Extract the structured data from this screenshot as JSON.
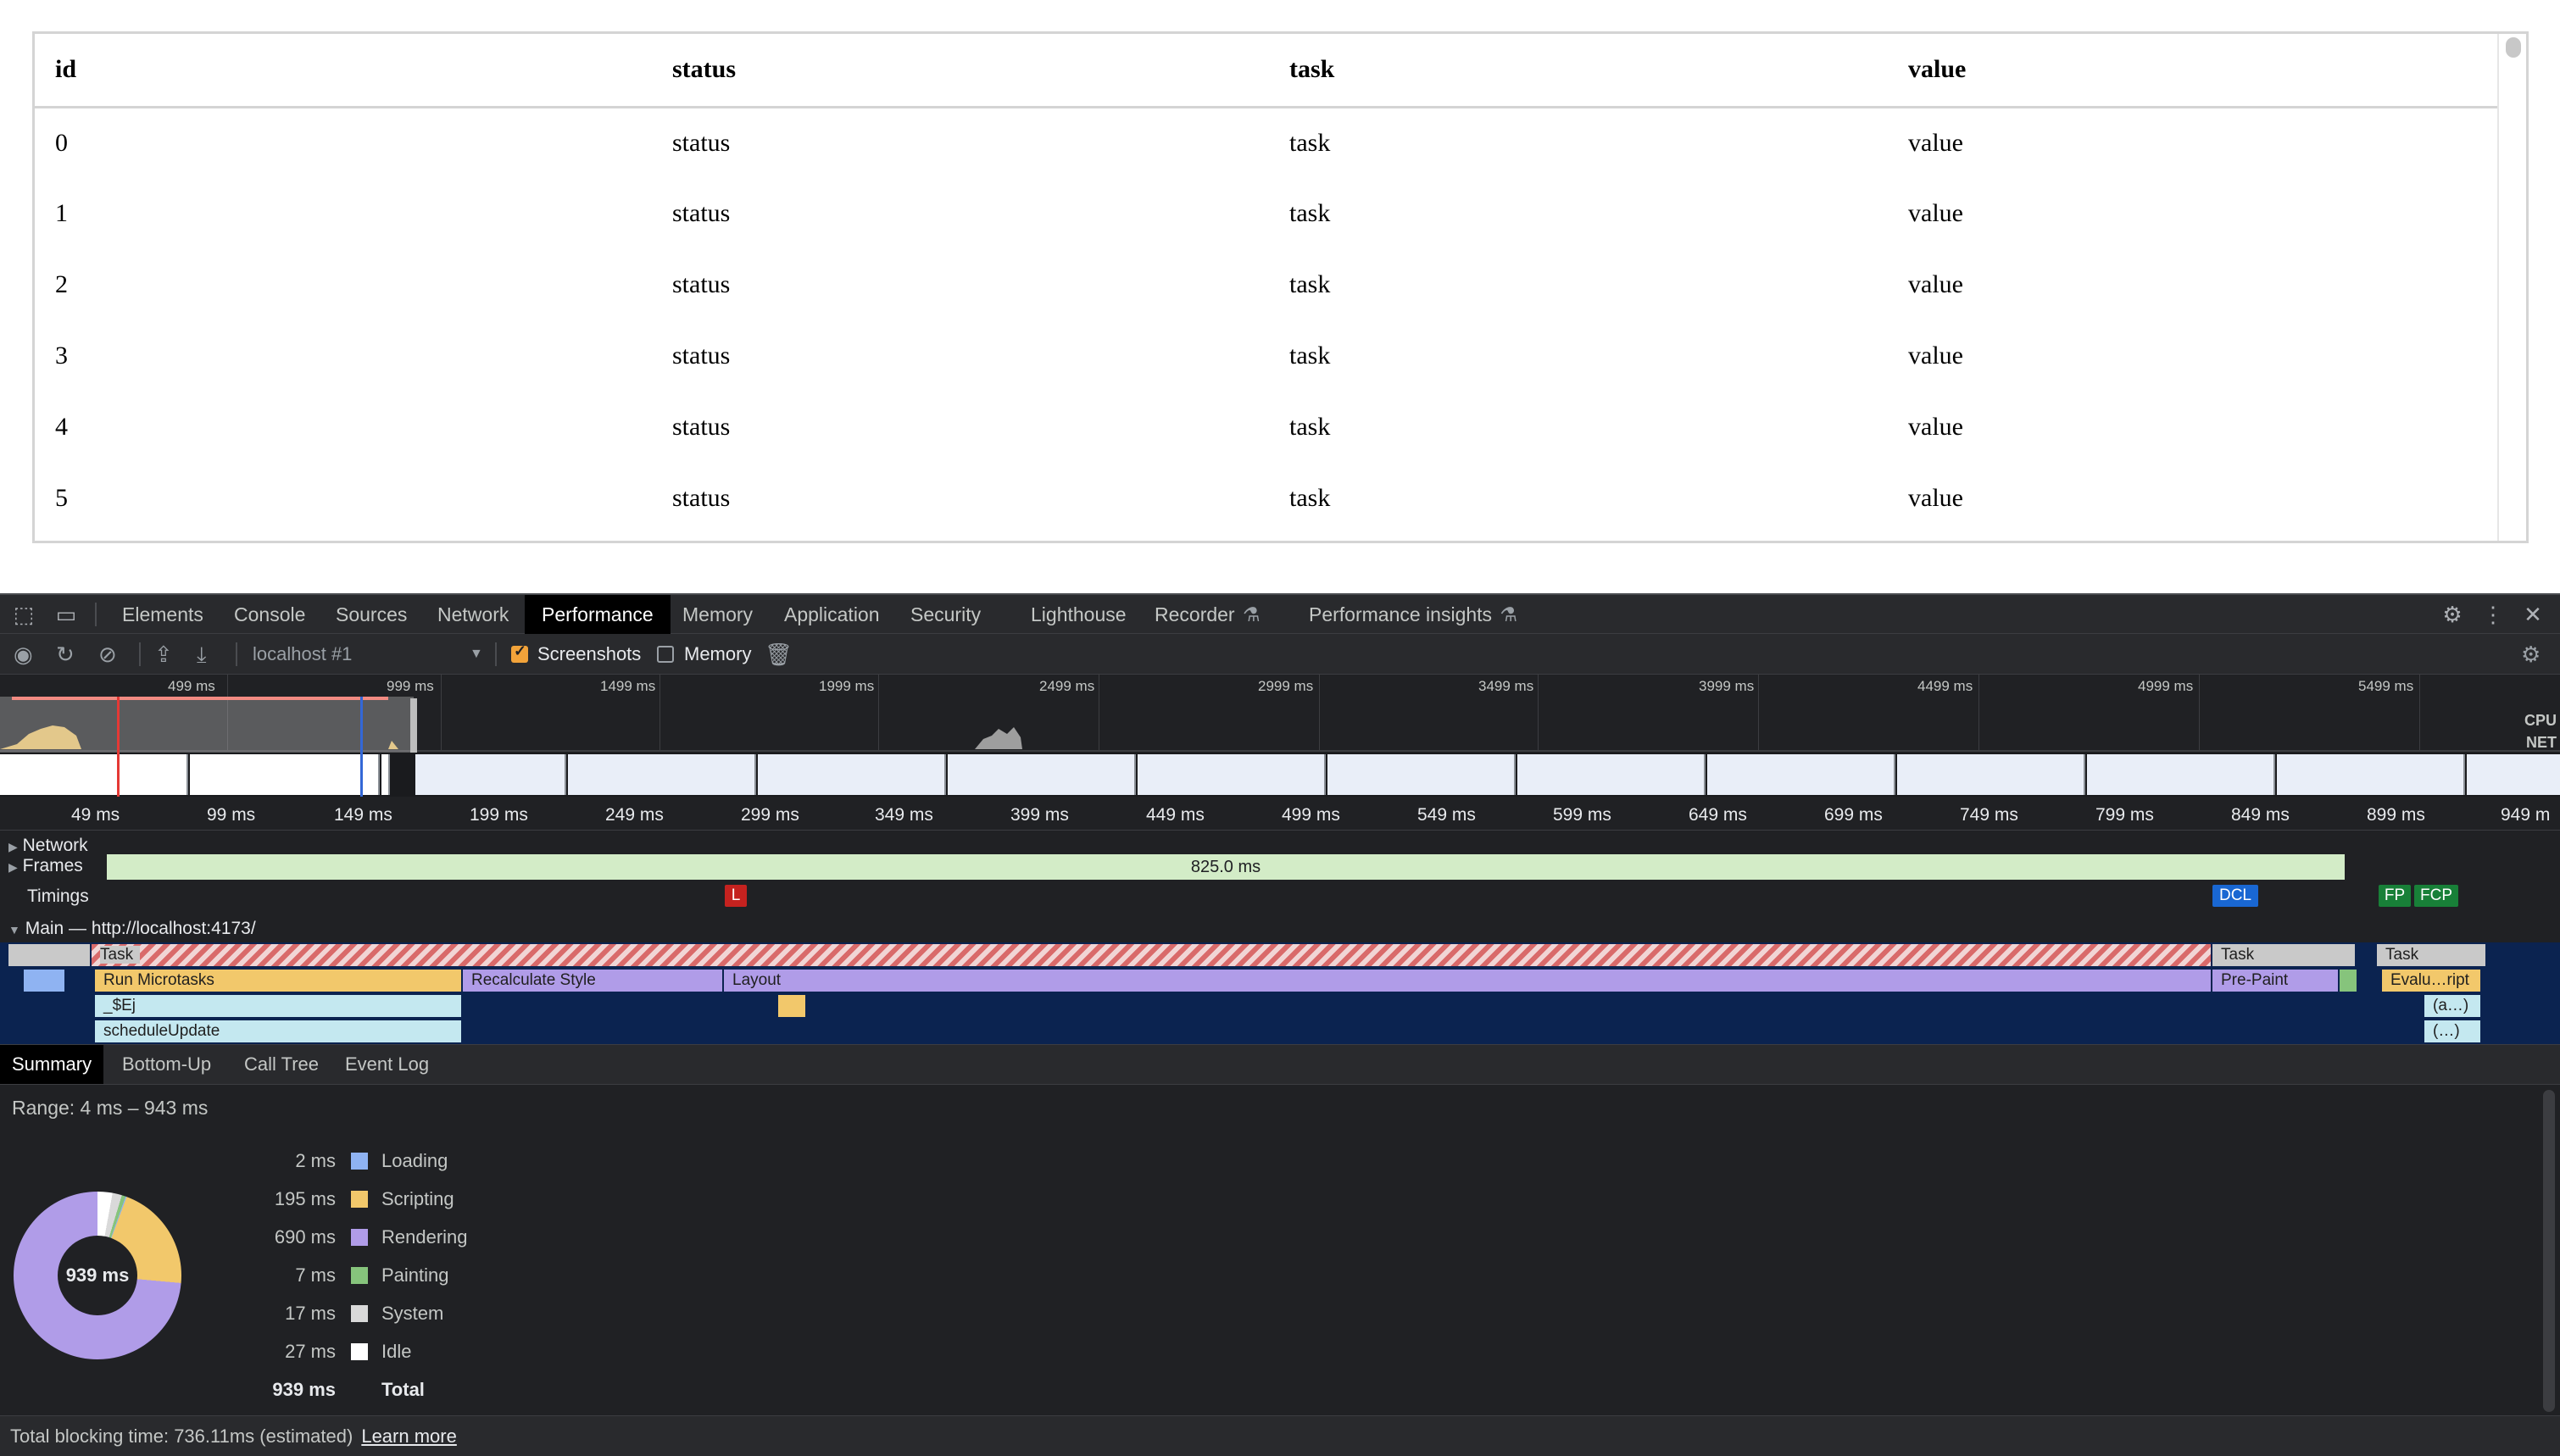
{
  "table": {
    "headers": [
      "id",
      "status",
      "task",
      "value"
    ],
    "rows": [
      [
        "0",
        "status",
        "task",
        "value"
      ],
      [
        "1",
        "status",
        "task",
        "value"
      ],
      [
        "2",
        "status",
        "task",
        "value"
      ],
      [
        "3",
        "status",
        "task",
        "value"
      ],
      [
        "4",
        "status",
        "task",
        "value"
      ],
      [
        "5",
        "status",
        "task",
        "value"
      ]
    ]
  },
  "devtools": {
    "tabs": [
      "Elements",
      "Console",
      "Sources",
      "Network",
      "Performance",
      "Memory",
      "Application",
      "Security",
      "Lighthouse",
      "Recorder",
      "Performance insights"
    ],
    "active_tab": "Performance",
    "target": "localhost #1",
    "screenshots_label": "Screenshots",
    "screenshots_checked": true,
    "memory_label": "Memory",
    "memory_checked": false,
    "overview_ticks": [
      "499 ms",
      "999 ms",
      "1499 ms",
      "1999 ms",
      "2499 ms",
      "2999 ms",
      "3499 ms",
      "3999 ms",
      "4499 ms",
      "4999 ms",
      "5499 ms"
    ],
    "cpu_label": "CPU",
    "net_label": "NET",
    "ruler_ticks": [
      "49 ms",
      "99 ms",
      "149 ms",
      "199 ms",
      "249 ms",
      "299 ms",
      "349 ms",
      "399 ms",
      "449 ms",
      "499 ms",
      "549 ms",
      "599 ms",
      "649 ms",
      "699 ms",
      "749 ms",
      "799 ms",
      "849 ms",
      "899 ms",
      "949 m"
    ],
    "tracks": {
      "network": "Network",
      "frames": "Frames",
      "timings": "Timings",
      "main": "Main — http://localhost:4173/"
    },
    "frame_duration": "825.0 ms",
    "markers": {
      "l": "L",
      "dcl": "DCL",
      "fp": "FP",
      "fcp": "FCP"
    },
    "flame": {
      "task1": "Task",
      "task2": "Task",
      "task3": "Task",
      "run_microtasks": "Run Microtasks",
      "recalc_style": "Recalculate Style",
      "layout": "Layout",
      "pre_paint": "Pre-Paint",
      "evaluate": "Evalu…ript",
      "ej": "_$Ej",
      "schedule_update": "scheduleUpdate",
      "anon1": "(a…)",
      "anon2": "(…)"
    },
    "bottom_tabs": [
      "Summary",
      "Bottom-Up",
      "Call Tree",
      "Event Log"
    ],
    "range": "Range: 4 ms – 943 ms",
    "summary": [
      {
        "value": "2 ms",
        "label": "Loading",
        "color": "#8fb3f2"
      },
      {
        "value": "195 ms",
        "label": "Scripting",
        "color": "#f2c86b"
      },
      {
        "value": "690 ms",
        "label": "Rendering",
        "color": "#b09ce8"
      },
      {
        "value": "7 ms",
        "label": "Painting",
        "color": "#86c47c"
      },
      {
        "value": "17 ms",
        "label": "System",
        "color": "#d9d9d9"
      },
      {
        "value": "27 ms",
        "label": "Idle",
        "color": "#ffffff"
      }
    ],
    "total_value": "939 ms",
    "total_label": "Total",
    "donut_center": "939 ms",
    "footer_text": "Total blocking time: 736.11ms (estimated)",
    "learn_more": "Learn more"
  }
}
